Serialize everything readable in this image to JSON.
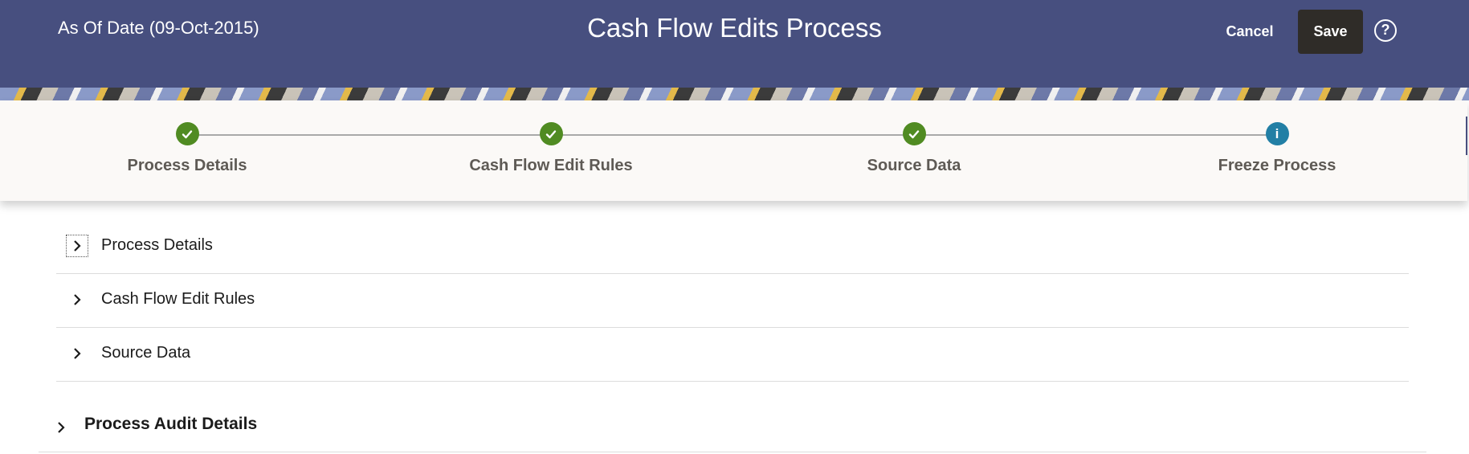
{
  "header": {
    "as_of_date": "As Of Date (09-Oct-2015)",
    "title": "Cash Flow Edits Process",
    "cancel_label": "Cancel",
    "save_label": "Save",
    "help_glyph": "?"
  },
  "train": {
    "steps": [
      {
        "label": "Process Details",
        "status": "complete",
        "icon": "check-icon"
      },
      {
        "label": "Cash Flow Edit Rules",
        "status": "complete",
        "icon": "check-icon"
      },
      {
        "label": "Source Data",
        "status": "complete",
        "icon": "check-icon"
      },
      {
        "label": "Freeze Process",
        "status": "current",
        "icon": "info-icon",
        "glyph": "i"
      }
    ]
  },
  "sections": [
    {
      "label": "Process Details",
      "expanded": false
    },
    {
      "label": "Cash Flow Edit Rules",
      "expanded": false
    },
    {
      "label": "Source Data",
      "expanded": false
    }
  ],
  "audit": {
    "label": "Process Audit Details",
    "expanded": false
  },
  "colors": {
    "header_bg": "#474f7f",
    "step_complete": "#508b22",
    "step_current": "#227fa5",
    "save_bg": "#2f2c28"
  }
}
